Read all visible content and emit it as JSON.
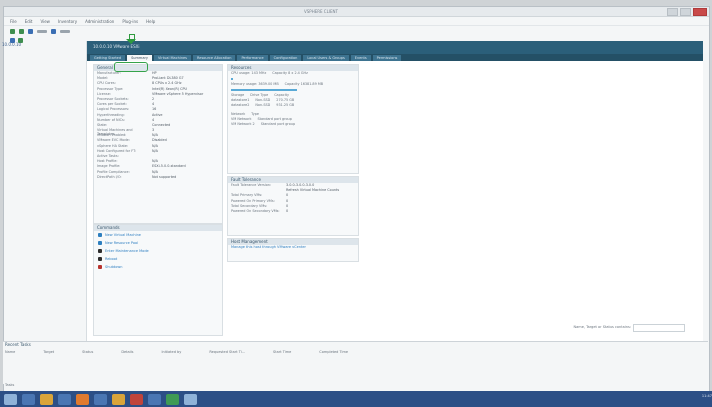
{
  "window": {
    "title": "VSPHERE CLIENT"
  },
  "menu": [
    "File",
    "Edit",
    "View",
    "Inventory",
    "Administration",
    "Plug-ins",
    "Help"
  ],
  "inventory": {
    "root": "10.0.0.10"
  },
  "host": {
    "name": "10.0.0.10 VMware ESXi",
    "tabs": [
      "Getting Started",
      "Summary",
      "Virtual Machines",
      "Resource Allocation",
      "Performance",
      "Configuration",
      "Local Users & Groups",
      "Events",
      "Permissions"
    ]
  },
  "general": {
    "title": "General",
    "rows": [
      [
        "Manufacturer:",
        "HP"
      ],
      [
        "Model:",
        "ProLiant DL380 G7"
      ],
      [
        "CPU Cores:",
        "8 CPUs x 2.4 GHz"
      ],
      [
        "Processor Type:",
        "Intel(R) Xeon(R) CPU"
      ],
      [
        "License:",
        "VMware vSphere 5 Hypervisor"
      ],
      [
        "Processor Sockets:",
        "2"
      ],
      [
        "Cores per Socket:",
        "4"
      ],
      [
        "Logical Processors:",
        "16"
      ],
      [
        "Hyperthreading:",
        "Active"
      ],
      [
        "Number of NICs:",
        "4"
      ],
      [
        "State:",
        "Connected"
      ],
      [
        "Virtual Machines and Templates:",
        "3"
      ],
      [
        "vMotion Enabled:",
        "N/A"
      ],
      [
        "VMware EVC Mode:",
        "Disabled"
      ],
      [
        "vSphere HA State:",
        "N/A"
      ],
      [
        "Host Configured for FT:",
        "N/A"
      ],
      [
        "Active Tasks:",
        ""
      ],
      [
        "Host Profile:",
        "N/A"
      ],
      [
        "Image Profile:",
        "ESXi-5.0.0-standard"
      ],
      [
        "Profile Compliance:",
        "N/A"
      ],
      [
        "DirectPath I/O:",
        "Not supported"
      ]
    ]
  },
  "commands": {
    "title": "Commands",
    "items": [
      "New Virtual Machine",
      "New Resource Pool",
      "Enter Maintenance Mode",
      "Reboot",
      "Shutdown"
    ]
  },
  "resources": {
    "title": "Resources",
    "cpu_label": "CPU usage: 143 MHz",
    "cpu_capacity": "Capacity 8 x 2.4 GHz",
    "mem_label": "Memory usage: 3639.00 MB",
    "mem_capacity": "Capacity 16381.89 MB",
    "cpu_fill": 0.02,
    "mem_fill": 0.22,
    "storage_cols": [
      "Storage",
      "Drive Type",
      "Capacity"
    ],
    "storage_rows": [
      [
        "datastore1",
        "Non-SSD",
        "270.75 GB"
      ],
      [
        "datastore2",
        "Non-SSD",
        "931.25 GB"
      ]
    ],
    "network_cols": [
      "Network",
      "Type"
    ],
    "network_rows": [
      [
        "VM Network",
        "Standard port group"
      ],
      [
        "VM Network 2",
        "Standard port group"
      ]
    ]
  },
  "fault": {
    "title": "Fault Tolerance",
    "rows": [
      [
        "Fault Tolerance Version:",
        "3.0.0-3.0.0-3.0.0"
      ],
      [
        "",
        "Refresh Virtual Machine Counts"
      ],
      [
        "Total Primary VMs:",
        "0"
      ],
      [
        "Powered On Primary VMs:",
        "0"
      ],
      [
        "Total Secondary VMs:",
        "0"
      ],
      [
        "Powered On Secondary VMs:",
        "0"
      ]
    ]
  },
  "host_mgmt": {
    "title": "Host Management",
    "link": "Manage this host through VMware vCenter"
  },
  "search": {
    "label": "Name, Target or Status contains:"
  },
  "recent": {
    "title": "Recent Tasks",
    "cols": [
      "Name",
      "Target",
      "Status",
      "Details",
      "Initiated by",
      "Requested Start Ti...",
      "Start Time",
      "Completed Time"
    ]
  },
  "status": {
    "text": "Tasks"
  },
  "taskbar": {
    "clock": "11:47"
  }
}
